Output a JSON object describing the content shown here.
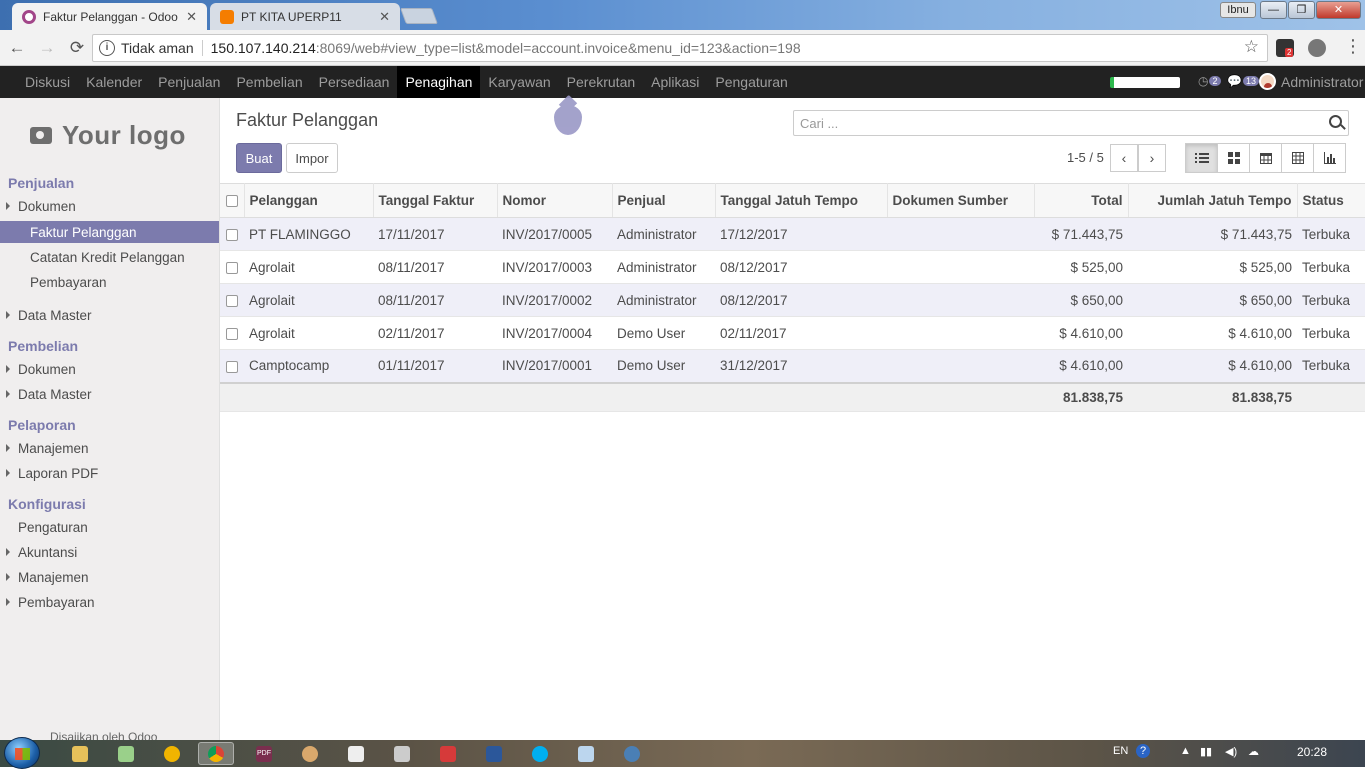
{
  "browser": {
    "tabs": [
      {
        "title": "Faktur Pelanggan - Odoo",
        "active": true,
        "favicon_color": "#a24689"
      },
      {
        "title": "PT KITA UPERP11",
        "active": false,
        "favicon_color": "#f57d00"
      }
    ],
    "close_glyph": "✕",
    "window_user": "Ibnu",
    "window_controls": {
      "minimize": "—",
      "maximize": "❐",
      "close": "✕"
    },
    "nav": {
      "back": "←",
      "forward": "→",
      "reload": "⟳"
    },
    "address": {
      "security_label": "Tidak aman",
      "host": "150.107.140.214",
      "path": ":8069/web#view_type=list&model=account.invoice&menu_id=123&action=198"
    },
    "star_glyph": "☆",
    "extension_badge": "2",
    "menu_glyph": "⋮"
  },
  "odoo_menu": {
    "items": [
      "Diskusi",
      "Kalender",
      "Penjualan",
      "Pembelian",
      "Persediaan",
      "Penagihan",
      "Karyawan",
      "Perekrutan",
      "Aplikasi",
      "Pengaturan"
    ],
    "active": "Penagihan",
    "activity_count": "2",
    "message_count": "13",
    "user": "Administrator",
    "accent_color": "#7c7bad"
  },
  "sidebar": {
    "logo_text": "Your logo",
    "sections": [
      {
        "title": "Penjualan"
      },
      {
        "title": "Pembelian"
      },
      {
        "title": "Pelaporan"
      },
      {
        "title": "Konfigurasi"
      }
    ],
    "items": [
      "Dokumen",
      "Faktur Pelanggan",
      "Catatan Kredit Pelanggan",
      "Pembayaran",
      "Data Master",
      "Dokumen",
      "Data Master",
      "Manajemen",
      "Laporan PDF",
      "Pengaturan",
      "Akuntansi",
      "Manajemen",
      "Pembayaran"
    ],
    "powered_by": "Disajikan oleh Odoo"
  },
  "control_panel": {
    "title": "Faktur Pelanggan",
    "create_label": "Buat",
    "import_label": "Impor",
    "search_placeholder": "Cari ...",
    "pager": "1-5 / 5",
    "pager_prev": "‹",
    "pager_next": "›"
  },
  "table": {
    "columns": [
      "Pelanggan",
      "Tanggal Faktur",
      "Nomor",
      "Penjual",
      "Tanggal Jatuh Tempo",
      "Dokumen Sumber",
      "Total",
      "Jumlah Jatuh Tempo",
      "Status"
    ],
    "rows": [
      [
        "PT FLAMINGGO",
        "17/11/2017",
        "INV/2017/0005",
        "Administrator",
        "17/12/2017",
        "",
        "$ 71.443,75",
        "$ 71.443,75",
        "Terbuka"
      ],
      [
        "Agrolait",
        "08/11/2017",
        "INV/2017/0003",
        "Administrator",
        "08/12/2017",
        "",
        "$ 525,00",
        "$ 525,00",
        "Terbuka"
      ],
      [
        "Agrolait",
        "08/11/2017",
        "INV/2017/0002",
        "Administrator",
        "08/12/2017",
        "",
        "$ 650,00",
        "$ 650,00",
        "Terbuka"
      ],
      [
        "Agrolait",
        "02/11/2017",
        "INV/2017/0004",
        "Demo User",
        "02/11/2017",
        "",
        "$ 4.610,00",
        "$ 4.610,00",
        "Terbuka"
      ],
      [
        "Camptocamp",
        "01/11/2017",
        "INV/2017/0001",
        "Demo User",
        "31/12/2017",
        "",
        "$ 4.610,00",
        "$ 4.610,00",
        "Terbuka"
      ]
    ],
    "totals": {
      "total": "81.838,75",
      "amount_due": "81.838,75"
    }
  },
  "taskbar": {
    "pdf_label": "PDF",
    "language": "EN",
    "help_glyph": "?",
    "clock": "20:28"
  }
}
